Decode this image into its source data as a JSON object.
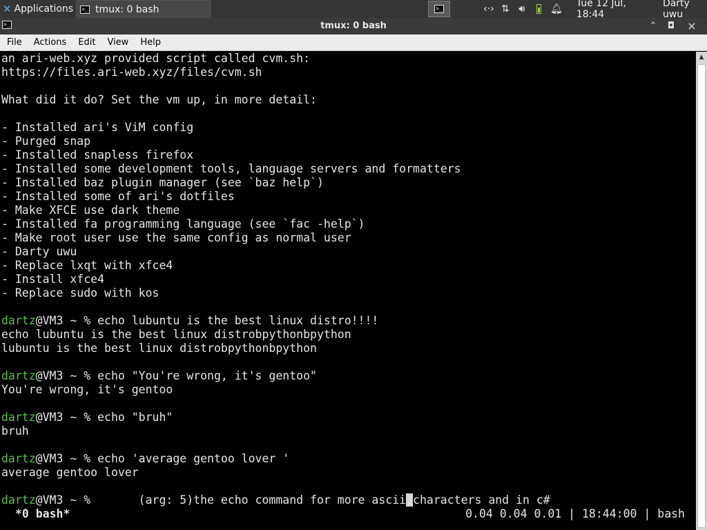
{
  "panel": {
    "apps_label": "Applications",
    "task_label": "tmux: 0 bash",
    "clock": "Tue 12 Jul, 18:44",
    "user": "Darty uwu",
    "tray_icons": [
      "network-arrows-icon",
      "transfer-icon",
      "volume-icon",
      "battery-icon",
      "notification-bell-icon"
    ]
  },
  "window": {
    "title": "tmux: 0 bash",
    "menu": [
      "File",
      "Actions",
      "Edit",
      "View",
      "Help"
    ]
  },
  "terminal": {
    "lines": [
      "an ari-web.xyz provided script called cvm.sh:",
      "https://files.ari-web.xyz/files/cvm.sh",
      "",
      "What did it do? Set the vm up, in more detail:",
      "",
      "- Installed ari's ViM config",
      "- Purged snap",
      "- Installed snapless firefox",
      "- Installed some development tools, language servers and formatters",
      "- Installed baz plugin manager (see `baz help`)",
      "- Installed some of ari's dotfiles",
      "- Make XFCE use dark theme",
      "- Installed fa programming language (see `fac -help`)",
      "- Make root user use the same config as normal user",
      "- Darty uwu",
      "- Replace lxqt with xfce4",
      "- Install xfce4",
      "- Replace sudo with kos",
      "",
      {
        "user": "dartz",
        "rest": "@VM3 ~ % echo lubuntu is the best linux distro!!!!"
      },
      "echo lubuntu is the best linux distrobpythonbpython",
      "lubuntu is the best linux distrobpythonbpython",
      "",
      {
        "user": "dartz",
        "rest": "@VM3 ~ % echo \"You're wrong, it's gentoo\""
      },
      "You're wrong, it's gentoo",
      "",
      {
        "user": "dartz",
        "rest": "@VM3 ~ % echo \"bruh\""
      },
      "bruh",
      "",
      {
        "user": "dartz",
        "rest": "@VM3 ~ % echo 'average gentoo lover '"
      },
      "average gentoo lover",
      "",
      {
        "user": "dartz",
        "rest": "@VM3 ~ %       (arg: 5)the echo command for more ascii",
        "cursor": " ",
        "after": "characters and in c#"
      }
    ],
    "status_left": " *0 bash*",
    "status_right": "0.04 0.04 0.01 | 18:44:00 | bash"
  }
}
